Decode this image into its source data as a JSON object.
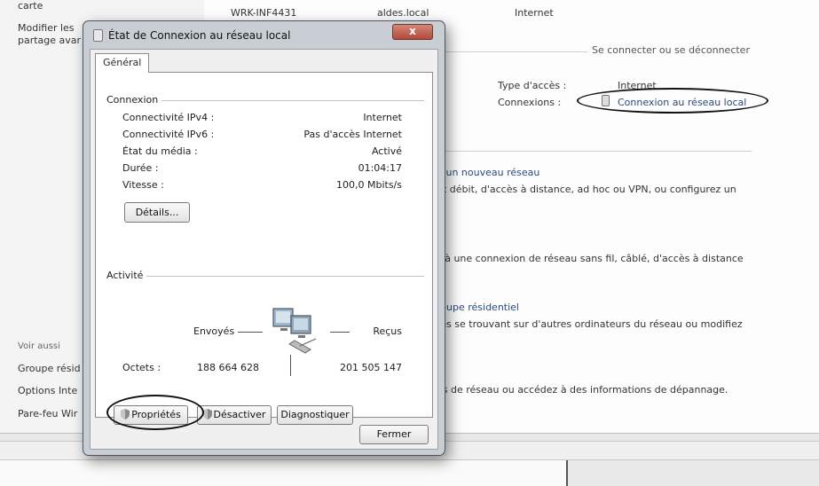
{
  "background": {
    "top_row": {
      "computer": "WRK-INF4431",
      "domain": "aldes.local",
      "internet": "Internet"
    },
    "sidebar": {
      "carte_label": "carte",
      "modify_sharing_1": "Modifier les",
      "modify_sharing_2": "partage avar",
      "see_also": "Voir aussi",
      "links": [
        "Groupe résid",
        "Options Inte",
        "Pare-feu Wir"
      ]
    },
    "connect_disconnect": "Se connecter ou se déconnecter",
    "access_type_label": "Type d'accès :",
    "access_type_value": "Internet",
    "connections_label": "Connexions :",
    "connections_value": "Connexion au réseau local",
    "tasks": {
      "new_network_title": "u un nouveau réseau",
      "new_network_desc": "ut débit, d'accès à distance, ad hoc ou VPN, ou configurez un",
      "connect_desc": "s à une connexion de réseau sans fil, câblé, d'accès à distance",
      "homegroup_title": "roupe résidentiel",
      "homegroup_desc": "tes se trouvant sur d'autres ordinateurs du réseau ou modifiez",
      "troubleshoot_desc": "es de réseau ou accédez à des informations de dépannage."
    }
  },
  "dialog": {
    "title": "État de Connexion au réseau local",
    "close_glyph": "x",
    "tab_general": "Général",
    "connexion_group": "Connexion",
    "rows": [
      {
        "label": "Connectivité IPv4 :",
        "value": "Internet"
      },
      {
        "label": "Connectivité IPv6 :",
        "value": "Pas d'accès Internet"
      },
      {
        "label": "État du média :",
        "value": "Activé"
      },
      {
        "label": "Durée :",
        "value": "01:04:17"
      },
      {
        "label": "Vitesse :",
        "value": "100,0 Mbits/s"
      }
    ],
    "details_button": "Détails...",
    "activity_group": "Activité",
    "sent_label": "Envoyés",
    "received_label": "Reçus",
    "bytes_label": "Octets :",
    "bytes_sent": "188 664 628",
    "bytes_received": "201 505 147",
    "properties_button": "Propriétés",
    "disable_button": "Désactiver",
    "diagnose_button": "Diagnostiquer",
    "close_button": "Fermer"
  }
}
